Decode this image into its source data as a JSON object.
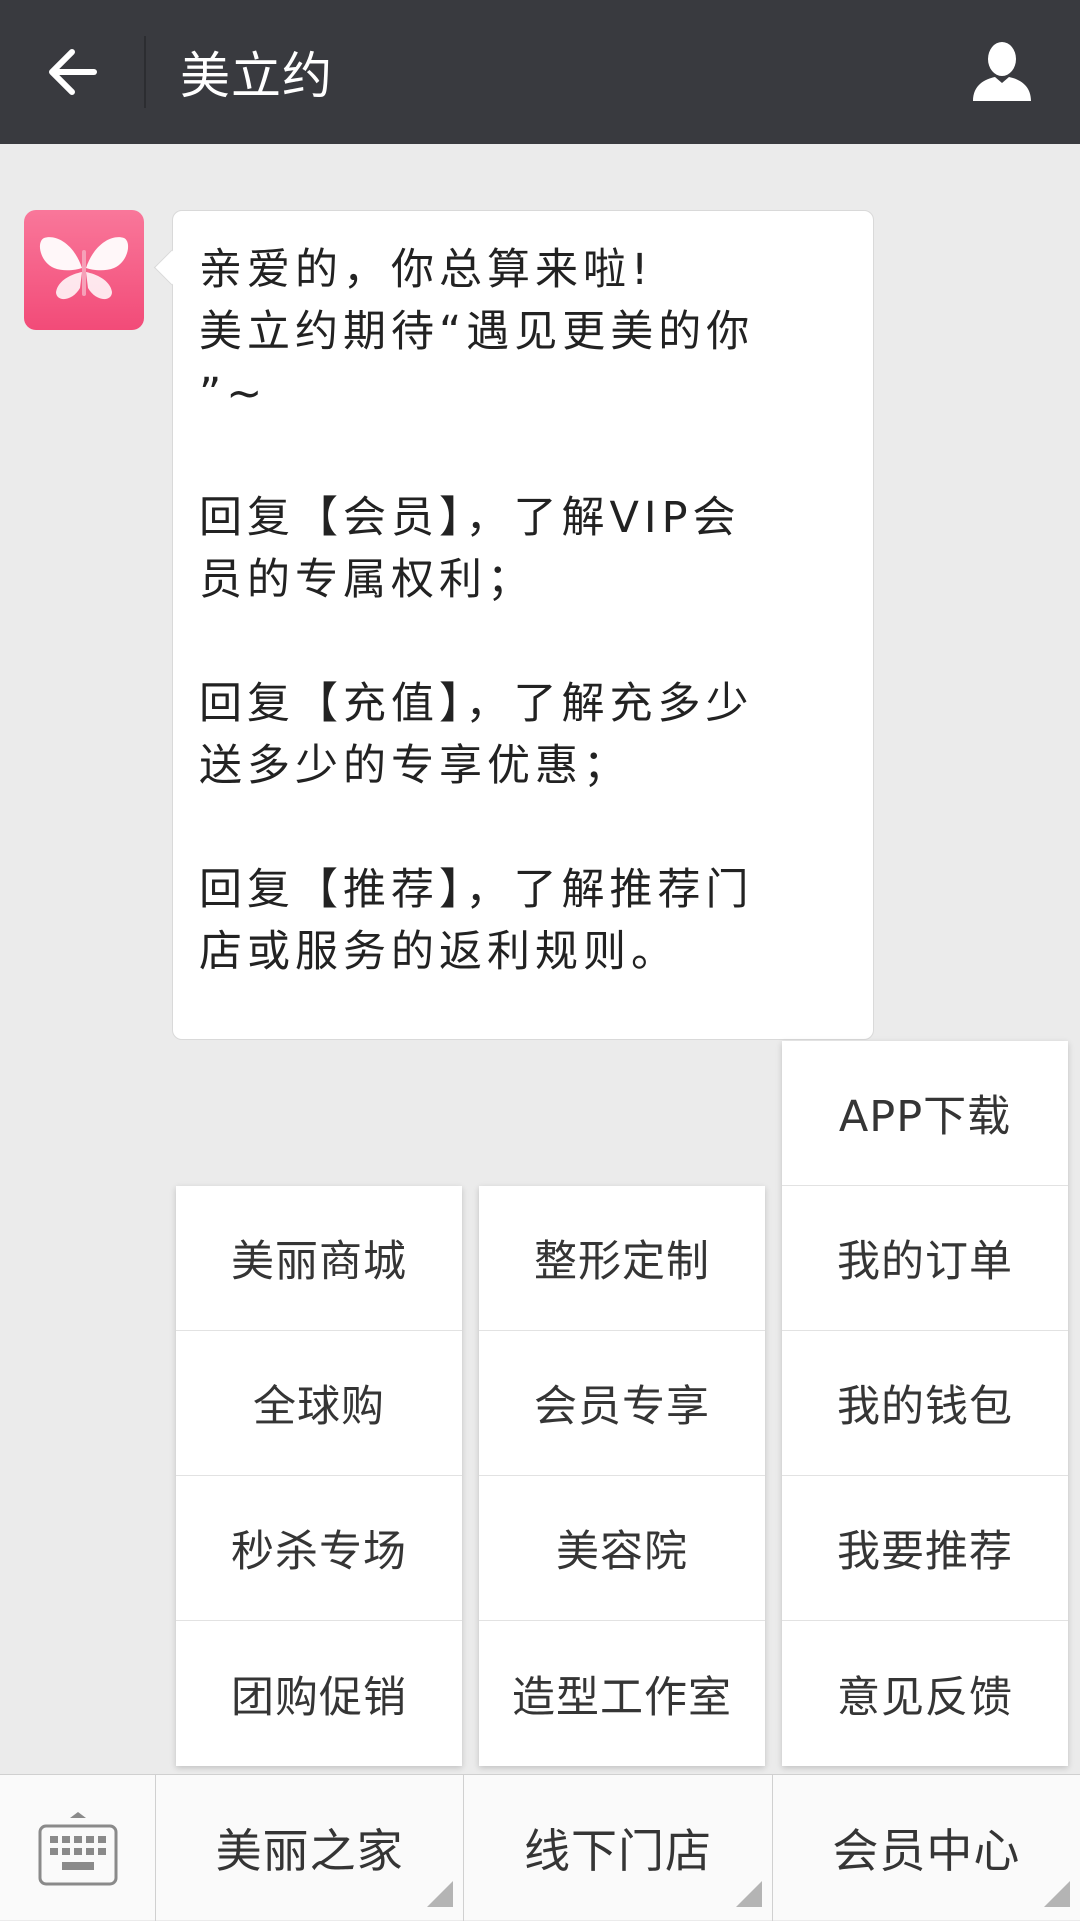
{
  "header": {
    "title": "美立约",
    "back_icon": "arrow-left-icon",
    "profile_icon": "person-icon"
  },
  "chat": {
    "avatar_icon": "butterfly-logo-icon",
    "message_lines": [
      "亲爱的，你总算来啦!",
      "美立约期待“遇见更美的你",
      "”~",
      "",
      "回复【会员】，了解VIP会",
      "员的专属权利；",
      "",
      "回复【充值】，了解充多少",
      "送多少的专享优惠；",
      "",
      "回复【推荐】，了解推荐门",
      "店或服务的返利规则。"
    ]
  },
  "popup_menus": {
    "col1": [
      "美丽商城",
      "全球购",
      "秒杀专场",
      "团购促销"
    ],
    "col2": [
      "整形定制",
      "会员专享",
      "美容院",
      "造型工作室"
    ],
    "col3": [
      "APP下载",
      "我的订单",
      "我的钱包",
      "我要推荐",
      "意见反馈"
    ]
  },
  "bottom_menu": {
    "keyboard_icon": "keyboard-icon",
    "tabs": [
      "美丽之家",
      "线下门店",
      "会员中心"
    ]
  },
  "colors": {
    "header_bg": "#393a3f",
    "page_bg": "#ebebeb",
    "avatar_pink": "#f24b78"
  }
}
